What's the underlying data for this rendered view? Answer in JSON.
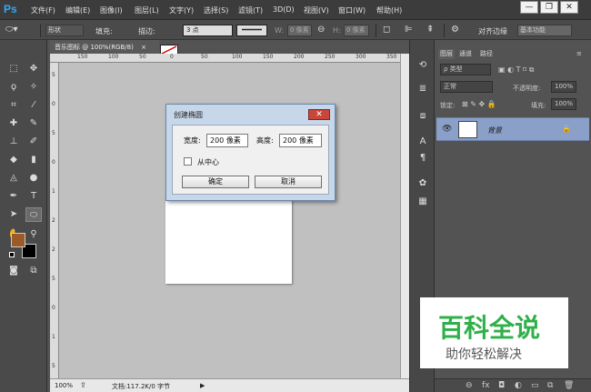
{
  "app": {
    "logo": "Ps"
  },
  "menu": [
    "文件(F)",
    "编辑(E)",
    "图像(I)",
    "图层(L)",
    "文字(Y)",
    "选择(S)",
    "滤镜(T)",
    "3D(D)",
    "视图(V)",
    "窗口(W)",
    "帮助(H)"
  ],
  "window_controls": {
    "minimize": "—",
    "restore": "❐",
    "close": "✕"
  },
  "options": {
    "mode": "形状",
    "fill_label": "填充:",
    "stroke_label": "描边:",
    "stroke_size": "3 点",
    "w_label": "W:",
    "w_value": "0 像素",
    "h_label": "H:",
    "h_value": "0 像素",
    "align_edges": "对齐边缘",
    "workspace": "基本功能",
    "fill_color": "#9a5a2a"
  },
  "document": {
    "tab": "音乐图标 @ 100%(RGB/8)",
    "close": "×",
    "ruler_top": [
      "150",
      "100",
      "50",
      "0",
      "50",
      "100",
      "150",
      "200",
      "250",
      "300",
      "350"
    ],
    "ruler_left": [
      "5",
      "0",
      "5",
      "0",
      "1",
      "2",
      "2",
      "5",
      "0",
      "1",
      "5"
    ],
    "zoom": "100%",
    "doc_info": "文档:117.2K/0 字节"
  },
  "dialog": {
    "title": "创建椭圆",
    "close": "✕",
    "width_label": "宽度:",
    "width_value": "200 像素",
    "height_label": "高度:",
    "height_value": "200 像素",
    "from_center": "从中心",
    "ok": "确定",
    "cancel": "取消"
  },
  "layers_panel": {
    "tabs": [
      "图层",
      "通道",
      "路径"
    ],
    "kind_filter": "ρ 类型",
    "blend_mode": "正常",
    "opacity_label": "不透明度:",
    "opacity_value": "100%",
    "lock_label": "锁定:",
    "fill_label": "填充:",
    "fill_value": "100%",
    "layer_name": "背景"
  },
  "colors": {
    "foreground": "#9a5a2a",
    "background": "#000000"
  },
  "watermark": {
    "title": "百科全说",
    "subtitle": "助你轻松解决"
  }
}
